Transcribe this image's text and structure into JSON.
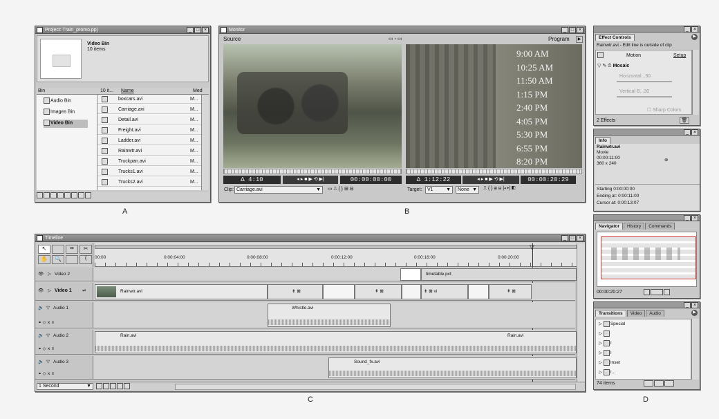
{
  "labels": {
    "a": "A",
    "b": "B",
    "c": "C",
    "d": "D"
  },
  "project": {
    "title": "Project: Train_promo.ppj",
    "bin_name": "Video Bin",
    "bin_count": "10 items",
    "col_bin": "Bin",
    "col_items": "10 it...",
    "col_name": "Name",
    "col_media": "Med",
    "bins": [
      {
        "label": "Audio Bin"
      },
      {
        "label": "Images Bin"
      },
      {
        "label": "Video Bin"
      }
    ],
    "files": [
      {
        "name": "boxcars.avi",
        "media": "M..."
      },
      {
        "name": "Carriage.avi",
        "media": "M..."
      },
      {
        "name": "Detail.avi",
        "media": "M..."
      },
      {
        "name": "Freight.avi",
        "media": "M..."
      },
      {
        "name": "Ladder.avi",
        "media": "M..."
      },
      {
        "name": "Rainwtr.avi",
        "media": "M..."
      },
      {
        "name": "Truckpan.avi",
        "media": "M..."
      },
      {
        "name": "Trucks1.avi",
        "media": "M..."
      },
      {
        "name": "Trucks2.avi",
        "media": "M..."
      }
    ]
  },
  "monitor": {
    "title": "Monitor",
    "source_label": "Source",
    "program_label": "Program",
    "src_duration": "Δ 4:10",
    "src_timecode": "00:00:00:00",
    "prg_duration": "Δ 1:12:22",
    "prg_timecode": "00:00:20:29",
    "clip_label": "Clip:",
    "clip_value": "Carriage.avi",
    "target_label": "Target:",
    "target_value": "V1",
    "none_value": "None",
    "overlay_times": [
      "9:00 AM",
      "10:25 AM",
      "11:50 AM",
      "1:15 PM",
      "2:40 PM",
      "4:05 PM",
      "5:30 PM",
      "6:55 PM",
      "8:20 PM"
    ]
  },
  "timeline": {
    "title": "Timeline",
    "ruler": [
      "00:00",
      "0:00:04:00",
      "0:00:08:00",
      "0:00:12:00",
      "0:00:16:00",
      "0:00:20:00"
    ],
    "tracks": {
      "video2": "Video 2",
      "video1": "Video 1",
      "audio1": "Audio 1",
      "audio2": "Audio 2",
      "audio3": "Audio 3"
    },
    "clips": {
      "timetable": "timetable.pct",
      "rainwtr": "Rainwtr.avi",
      "whistle": "Whistle.avi",
      "rain_left": "Rain.avi",
      "rain_right": "Rain.avi",
      "soundfx": "Sound_fx.avi",
      "fragment": "vi"
    },
    "zoom": "1 Second"
  },
  "effect_controls": {
    "tab": "Effect Controls",
    "status": "Rainwtr.avi - Edit line is outside of clip",
    "motion": "Motion",
    "setup": "Setup",
    "effect_name": "Mosaic",
    "horizontal": "Horizontal...30",
    "vertical": "Vertical B...30",
    "sharp": "Sharp Colors",
    "count": "2 Effects"
  },
  "info": {
    "tab": "Info",
    "clip": "Rainwtr.avi",
    "type": "Movie",
    "duration": "00:00:11:00",
    "size": "360 x 240",
    "starting": "Starting  0:00:00:00",
    "ending": "Ending at:  0:00:11:00",
    "cursor": "Cursor at: 0:00:13:07"
  },
  "navigator": {
    "tabs": [
      "Navigator",
      "History",
      "Commands"
    ],
    "timecode": "00:00:20:27"
  },
  "transitions": {
    "tabs": [
      "Transitions",
      "Video",
      "Audio"
    ],
    "folders": [
      "Special",
      "",
      "I",
      "I",
      "Inset",
      "I..."
    ],
    "count": "74 items"
  }
}
